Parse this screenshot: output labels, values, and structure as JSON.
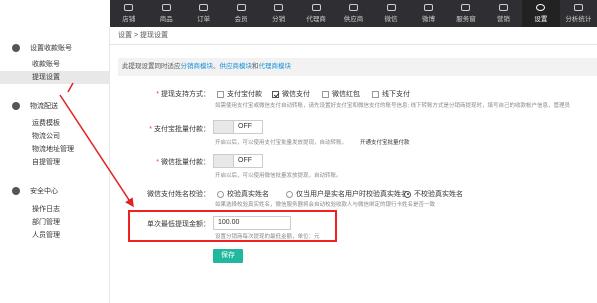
{
  "topnav": {
    "items": [
      {
        "label": "店铺",
        "icon": "shop-icon"
      },
      {
        "label": "商品",
        "icon": "goods-icon"
      },
      {
        "label": "订单",
        "icon": "order-icon"
      },
      {
        "label": "会员",
        "icon": "member-icon"
      },
      {
        "label": "分销",
        "icon": "distribution-icon"
      },
      {
        "label": "代理商",
        "icon": "agent-icon"
      },
      {
        "label": "供应商",
        "icon": "supplier-icon"
      },
      {
        "label": "微信",
        "icon": "wechat-icon"
      },
      {
        "label": "微博",
        "icon": "weibo-icon"
      },
      {
        "label": "服务窗",
        "icon": "service-window-icon"
      },
      {
        "label": "营销",
        "icon": "marketing-icon"
      },
      {
        "label": "设置",
        "icon": "settings-gear-icon"
      },
      {
        "label": "分析统计",
        "icon": "analytics-icon"
      }
    ],
    "active_index": 11
  },
  "sidebar": {
    "groups": [
      {
        "title": "设置收款账号",
        "items": [
          "收款账号",
          "提现设置"
        ]
      },
      {
        "title": "物流配送",
        "items": [
          "运费模板",
          "物流公司",
          "物流地址管理",
          "自提管理"
        ]
      },
      {
        "title": "安全中心",
        "items": [
          "操作日志",
          "部门管理",
          "人员管理"
        ]
      }
    ],
    "active_item": "提现设置"
  },
  "breadcrumb": {
    "text": "设置 > 提现设置"
  },
  "info": {
    "prefix": "此提现设置同时适应",
    "link1": "分销商模块",
    "sep": "、",
    "link2": "供应商模块",
    "mid": "和",
    "link3": "代理商模块"
  },
  "form": {
    "methods": {
      "label": "提现支持方式：",
      "options": [
        {
          "label": "支付宝付款",
          "checked": false
        },
        {
          "label": "微信支付",
          "checked": true
        },
        {
          "label": "微信红包",
          "checked": false
        },
        {
          "label": "线下支付",
          "checked": false
        }
      ],
      "hint": "如需使用支付宝或微信支付自动转账，请先设置好支付宝和微信支付的账号信息; 线下转账方式是分销商提现时，填写自己的收款帐户信息，管理员"
    },
    "alipay_batch": {
      "label": "支付宝批量付款：",
      "state": "OFF",
      "hint": "开启以后，可以使用支付宝批量发放提现，自动转账。",
      "link": "开通支付宝批量付款"
    },
    "wechat_batch": {
      "label": "微信批量付款：",
      "state": "OFF",
      "hint": "开启以后，可以使用微信批量发放提现，自动转账。"
    },
    "name_check": {
      "label": "微信支付姓名校验：",
      "options": [
        {
          "label": "校验真实姓名",
          "selected": false
        },
        {
          "label": "仅当用户是实名用户时校验真实姓名",
          "selected": false
        },
        {
          "label": "不校验真实姓名",
          "selected": true
        }
      ],
      "hint": "如果选择校验真实姓名，微信服务器将会自动校验收款人与微信绑定的银行卡姓名是否一致"
    },
    "min_amount": {
      "label": "单次最低提现金额：",
      "value": "100.00",
      "hint": "设置分销商每次提现的最低金额，单位：元"
    },
    "save_label": "保存"
  },
  "colors": {
    "accent": "#21b8a0",
    "link": "#1b8fd6",
    "annotation": "#e22222",
    "nav_bg": "#2f2f33"
  }
}
